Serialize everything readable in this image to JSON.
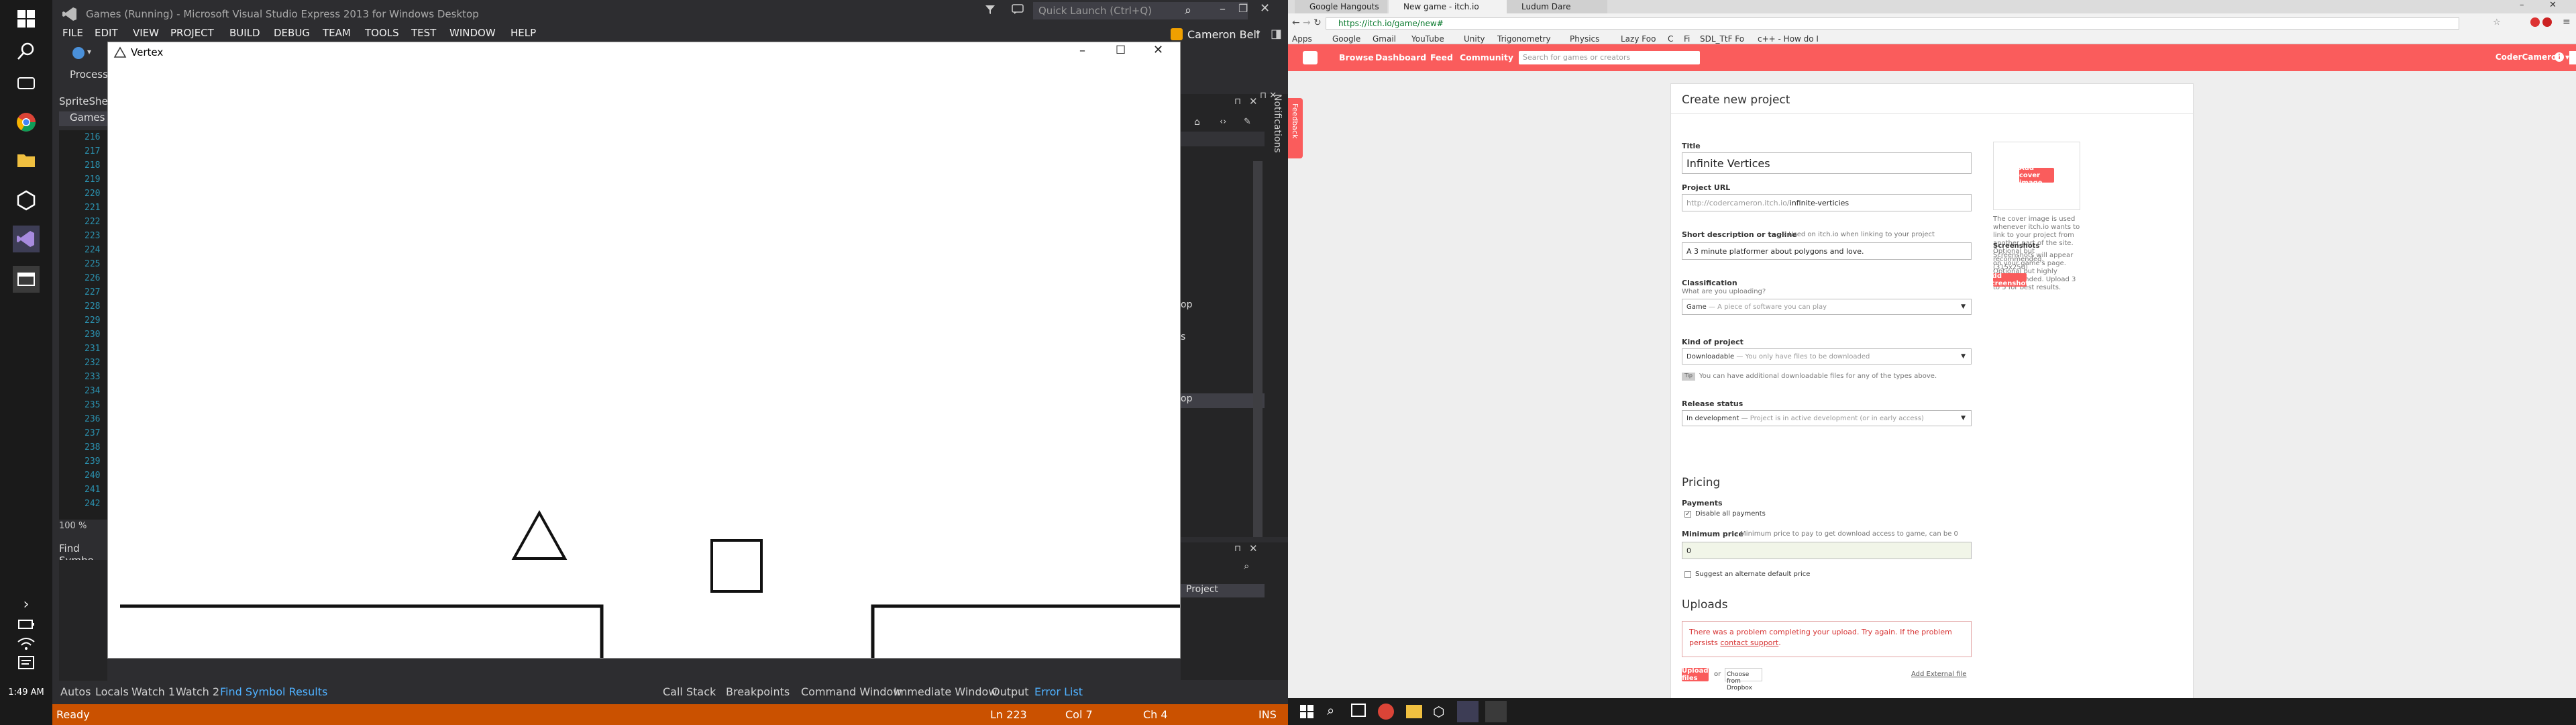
{
  "left_taskbar": {
    "time": "1:49 AM"
  },
  "vs": {
    "title": "Games (Running) - Microsoft Visual Studio Express 2013 for Windows Desktop",
    "quick_launch": "Quick Launch (Ctrl+Q)",
    "user": "Cameron Bell",
    "menu": [
      "FILE",
      "EDIT",
      "VIEW",
      "PROJECT",
      "BUILD",
      "DEBUG",
      "TEAM",
      "TOOLS",
      "TEST",
      "WINDOW",
      "HELP"
    ],
    "process_label": "Process:",
    "doc_tab": "SpriteShee",
    "doc_tab2": "Games",
    "line_numbers": [
      "216",
      "217",
      "218",
      "219",
      "220",
      "221",
      "222",
      "223",
      "224",
      "225",
      "226",
      "227",
      "228",
      "229",
      "230",
      "231",
      "232",
      "233",
      "234",
      "235",
      "236",
      "237",
      "238",
      "239",
      "240",
      "241",
      "242"
    ],
    "zoom": "100 %",
    "find_symbol": "Find Symbo",
    "notifications": "Notifications",
    "bottom_tabs_left": [
      "Autos",
      "Locals",
      "Watch 1",
      "Watch 2",
      "Find Symbol Results"
    ],
    "bottom_tabs_right": [
      "Call Stack",
      "Breakpoints",
      "Command Window",
      "Immediate Window",
      "Output",
      "Error List"
    ],
    "right_panel_text": [
      "op",
      "s",
      "op"
    ],
    "project_label": "Project",
    "status": {
      "ready": "Ready",
      "ln": "Ln 223",
      "col": "Col 7",
      "ch": "Ch 4",
      "ins": "INS"
    }
  },
  "vertex": {
    "title": "Vertex"
  },
  "chrome": {
    "tabs": [
      "Google Hangouts",
      "New game - itch.io",
      "Ludum Dare"
    ],
    "url": "https://itch.io/game/new#",
    "bookmarks": [
      "Apps",
      "Google",
      "Gmail",
      "YouTube",
      "Unity",
      "Trigonometry",
      "Physics",
      "Lazy Foo",
      "C",
      "Fi",
      "SDL_TtF Fo",
      "c++ - How do I"
    ],
    "user": "CoderCameron"
  },
  "itch": {
    "nav": [
      "Browse",
      "Dashboard",
      "Feed",
      "Community"
    ],
    "search_placeholder": "Search for games or creators",
    "feedback": "Feedback",
    "page_title": "Create new project",
    "title_label": "Title",
    "title_value": "Infinite Vertices",
    "url_label": "Project URL",
    "url_prefix": "http://codercameron.itch.io/",
    "url_slug": "infinite-verticies",
    "short_desc_label": "Short description or tagline",
    "short_desc_hint": "— Used on itch.io when linking to your project",
    "short_desc_value": "A 3 minute platformer about polygons and love.",
    "class_label": "Classification",
    "class_hint": "What are you uploading?",
    "class_value": "Game",
    "class_value_hint": "— A piece of software you can play",
    "kind_label": "Kind of project",
    "kind_value": "Downloadable",
    "kind_value_hint": "— You only have files to be downloaded",
    "tip_badge": "Tip",
    "tip_text": "You can have additional downloadable files for any of the types above.",
    "release_label": "Release status",
    "release_value": "In development",
    "release_value_hint": "— Project is in active development (or in early access)",
    "pricing": "Pricing",
    "payments_label": "Payments",
    "disable_payments": "Disable all payments",
    "min_price_label": "Minimum price",
    "min_price_hint": "— Minimum price to pay to get download access to game, can be 0",
    "min_price_value": "0",
    "suggest_alt": "Suggest an alternate default price",
    "uploads": "Uploads",
    "error_text": "There was a problem completing your upload. Try again. If the problem persists",
    "error_link": "contact support",
    "upload_files": "Upload files",
    "or": "or",
    "dropbox": "Choose from Dropbox",
    "external_file": "Add External file",
    "cover_button": "Add cover image",
    "cover_help": "The cover image is used whenever itch.io wants to link to your project from another part of the site. Optional but recommended. (315x250)",
    "screenshots_label": "Screenshots",
    "screenshots_help": "Screenshots will appear on your game's page. Optional but highly recommended. Upload 3 to 5 for best results.",
    "add_screenshots": "Add screenshots"
  },
  "colors": {
    "vs_status": "#ca5100",
    "itch_red": "#fa5c5c",
    "vs_bg": "#2d2d30"
  }
}
